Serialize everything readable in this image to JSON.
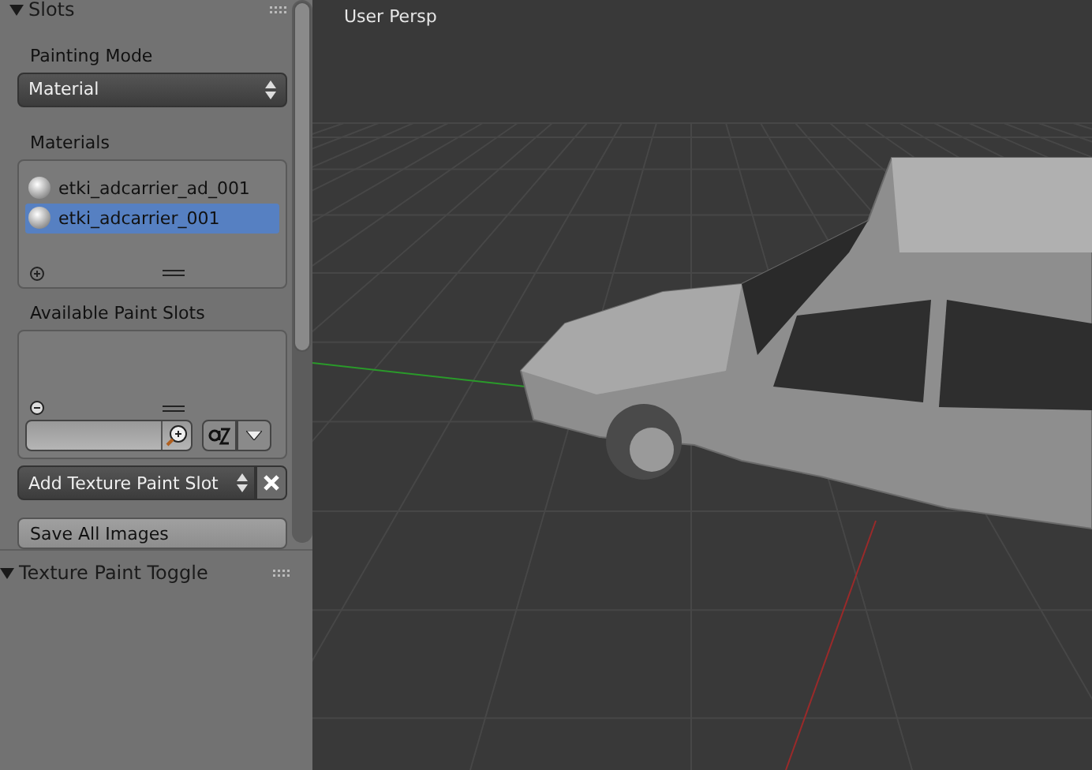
{
  "slots_panel": {
    "title": "Slots",
    "expanded": true
  },
  "painting_mode": {
    "label": "Painting Mode",
    "value": "Material"
  },
  "materials": {
    "label": "Materials",
    "items": [
      {
        "name": "etki_adcarrier_ad_001",
        "selected": false
      },
      {
        "name": "etki_adcarrier_001",
        "selected": true
      }
    ]
  },
  "paint_slots": {
    "label": "Available Paint Slots"
  },
  "add_slot": {
    "value": "Add Texture Paint Slot"
  },
  "save_button": "Save All Images",
  "toggle_panel": {
    "title": "Texture Paint Toggle",
    "expanded": true
  },
  "viewport": {
    "label": "User Persp"
  }
}
